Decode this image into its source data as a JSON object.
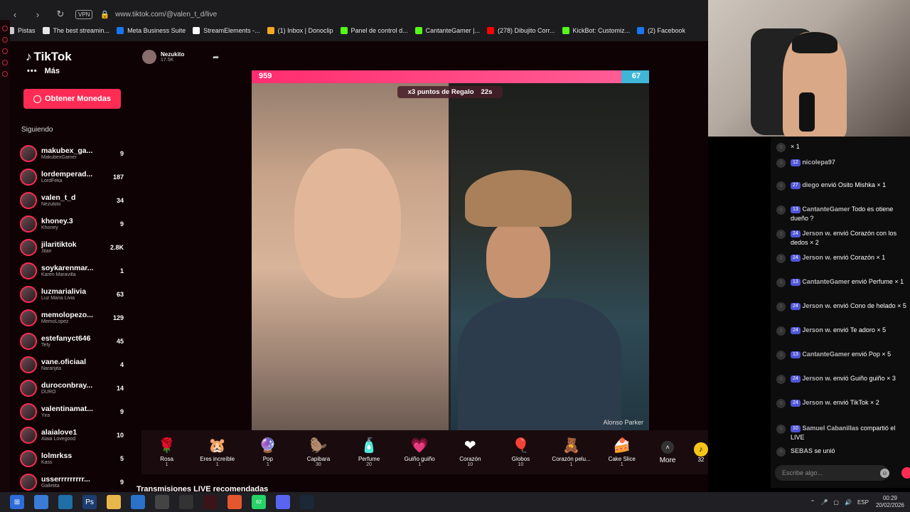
{
  "browser": {
    "vpn": "VPN",
    "url": "www.tiktok.com/@valen_t_d/live",
    "bookmarks": [
      {
        "label": "Pistas",
        "color": "#cccccc"
      },
      {
        "label": "The best streamin...",
        "color": "#e6e6e6"
      },
      {
        "label": "Meta Business Suite",
        "color": "#1877f2"
      },
      {
        "label": "StreamElements -...",
        "color": "#ffffff"
      },
      {
        "label": "(1) Inbox | Donoclip",
        "color": "#f5a623"
      },
      {
        "label": "Panel de control d...",
        "color": "#53fc18"
      },
      {
        "label": "CantanteGamer |...",
        "color": "#53fc18"
      },
      {
        "label": "(278) Dibujito Corr...",
        "color": "#ff0000"
      },
      {
        "label": "KickBot: Customiz...",
        "color": "#53fc18"
      },
      {
        "label": "(2) Facebook",
        "color": "#1877f2"
      }
    ]
  },
  "tiktok": {
    "logo": "TikTok",
    "more_label": "Más",
    "coins_button": "Obtener Monedas",
    "following_title": "Siguiendo",
    "following": [
      {
        "name": "makubex_ga...",
        "sub": "MakubexGamer",
        "count": "9"
      },
      {
        "name": "lordemperad...",
        "sub": "LordFeka",
        "count": "187"
      },
      {
        "name": "valen_t_d",
        "sub": "Nezukito",
        "count": "34"
      },
      {
        "name": "khoney.3",
        "sub": "Khoney",
        "count": "9"
      },
      {
        "name": "jilaritiktok",
        "sub": "Jilari",
        "count": "2.8K"
      },
      {
        "name": "soykarenmar...",
        "sub": "Karen Maravilla",
        "count": "1"
      },
      {
        "name": "luzmarialivia",
        "sub": "Luz Maria Livia",
        "count": "63"
      },
      {
        "name": "memolopezo...",
        "sub": "MemoLopez",
        "count": "129"
      },
      {
        "name": "estefanyct646",
        "sub": "Tefy",
        "count": "45"
      },
      {
        "name": "vane.oficiaal",
        "sub": "Naranjita",
        "count": "4"
      },
      {
        "name": "duroconbray...",
        "sub": "DURO",
        "count": "14"
      },
      {
        "name": "valentinamat...",
        "sub": "Yira",
        "count": "9"
      },
      {
        "name": "alaialove1",
        "sub": "Alaia Lovegood",
        "count": "10"
      },
      {
        "name": "lolmrkss",
        "sub": "Kass",
        "count": "5"
      },
      {
        "name": "usserrrrrrrrr...",
        "sub": "Galletita",
        "count": "9"
      }
    ],
    "host_name": "Nezukito",
    "host_likes": "17.5K",
    "score_left": "959",
    "score_right": "67",
    "regalo_text": "x3 puntos de Regalo",
    "regalo_time": "22s",
    "video_label": "Alonso Parker",
    "gifts": [
      {
        "name": "Rosa",
        "price": "1",
        "icon": "🌹"
      },
      {
        "name": "Eres increíble",
        "price": "1",
        "icon": "🐹"
      },
      {
        "name": "Pop",
        "price": "1",
        "icon": "🔮"
      },
      {
        "name": "Capibara",
        "price": "30",
        "icon": "🦫"
      },
      {
        "name": "Perfume",
        "price": "20",
        "icon": "🧴"
      },
      {
        "name": "Guiño guiño",
        "price": "1",
        "icon": "💗"
      },
      {
        "name": "Corazón",
        "price": "10",
        "icon": "❤"
      },
      {
        "name": "Globos",
        "price": "10",
        "icon": "🎈"
      },
      {
        "name": "Corazón pelu...",
        "price": "1",
        "icon": "🧸"
      },
      {
        "name": "Cake Slice",
        "price": "1",
        "icon": "🍰"
      }
    ],
    "more_gifts": "More",
    "coin_count": "32",
    "recommended": "Transmisiones LIVE recomendadas"
  },
  "chat": {
    "messages": [
      {
        "badge": "",
        "user": "",
        "text": "× 1"
      },
      {
        "badge": "12",
        "user": "nicolepa97",
        "text": ""
      },
      {
        "badge": "27",
        "user": "diego",
        "text": "envió Osito Mishka × 1"
      },
      {
        "badge": "13",
        "user": "CantanteGamer",
        "text": "Todo es otiene dueño ?"
      },
      {
        "badge": "24",
        "user": "Jerson w.",
        "text": "envió Corazón con los dedos × 2"
      },
      {
        "badge": "24",
        "user": "Jerson w.",
        "text": "envió Corazón × 1"
      },
      {
        "badge": "13",
        "user": "CantanteGamer",
        "text": "envió Perfume × 1"
      },
      {
        "badge": "24",
        "user": "Jerson w.",
        "text": "envió Cono de helado × 5"
      },
      {
        "badge": "24",
        "user": "Jerson w.",
        "text": "envió Te adoro × 5"
      },
      {
        "badge": "13",
        "user": "CantanteGamer",
        "text": "envió Pop × 5"
      },
      {
        "badge": "24",
        "user": "Jerson w.",
        "text": "envió Guiño guiño × 3"
      },
      {
        "badge": "24",
        "user": "Jerson w.",
        "text": "envió TikTok × 2"
      },
      {
        "badge": "10",
        "user": "Samuel Cabanillas",
        "text": "compartió el LIVE"
      },
      {
        "badge": "",
        "user": "SEBAS",
        "text": "se unió"
      }
    ],
    "input_placeholder": "Escribe algo..."
  },
  "taskbar": {
    "lang": "ESP",
    "time": "00:29",
    "date": "20/02/2026",
    "badge": "62"
  }
}
